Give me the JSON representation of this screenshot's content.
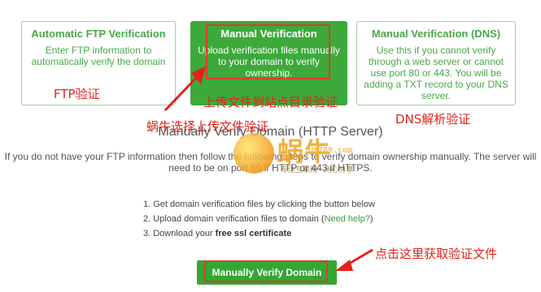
{
  "cards": {
    "ftp": {
      "title": "Automatic FTP Verification",
      "body": "Enter FTP information to automatically verify the domain"
    },
    "manual": {
      "title": "Manual Verification",
      "body": "Upload verification files manually to your domain to verify ownership."
    },
    "dns": {
      "title": "Manual Verification (DNS)",
      "body": "Use this if you cannot verify through a web server or cannot use port 80 or 443. You will be adding a TXT record to your DNS server."
    }
  },
  "annotations": {
    "ftp": "FTP验证",
    "manual": "上传文件到站点目录验证",
    "choice": "蜗牛选择上传文件验证",
    "dns": "DNS解析验证",
    "click": "点击这里获取验证文件"
  },
  "section_title": "Manually Verify Domain (HTTP Server)",
  "intro": "If you do not have your FTP information then follow the following steps to verify domain ownership manually. The server will need to be on port 80 if HTTP or 443 if HTTPS.",
  "steps": [
    "1. Get domain verification files by clicking the button below",
    "2. Upload domain verification files to domain (",
    "3. Download your "
  ],
  "steps_extra": {
    "help_link": "Need help?",
    "step2_end": ")",
    "ssl_bold": "free ssl certificate"
  },
  "button": {
    "label": "Manually Verify Domain"
  },
  "watermark": {
    "brand": "蜗牛",
    "url": "UN789.com",
    "sub": "专注互联网 · 用心分享"
  },
  "colors": {
    "green": "#3da93a",
    "red": "#e2231a",
    "card_border": "#9fd29a"
  }
}
